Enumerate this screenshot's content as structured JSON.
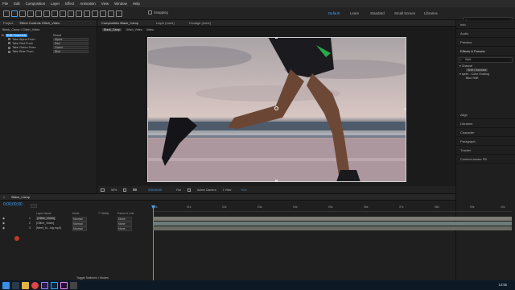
{
  "menu": [
    "File",
    "Edit",
    "Composition",
    "Layer",
    "Effect",
    "Animation",
    "View",
    "Window",
    "Help"
  ],
  "toolbar": {
    "snapping_label": "Snapping",
    "workspaces": [
      "Default",
      "Learn",
      "Standard",
      "Small Screen",
      "Libraries"
    ],
    "active_workspace": "Default",
    "search_placeholder": "Search Help"
  },
  "project_panel": {
    "tabs": [
      "Project",
      "Effect Controls Glitch_Video"
    ],
    "breadcrumb": "Black_Camp • Glitch_Video",
    "effect_name": "Shift Channels",
    "effect_reset": "Reset",
    "properties": [
      {
        "label": "Take Alpha From",
        "value": "Alpha"
      },
      {
        "label": "Take Red From",
        "value": "Red"
      },
      {
        "label": "Take Green From",
        "value": "Green"
      },
      {
        "label": "Take Blue From",
        "value": "Blue"
      }
    ]
  },
  "viewer": {
    "composition_tab": "Composition Black_Camp",
    "layer_tab": "Layer (none)",
    "footage_tab": "Footage (none)",
    "sub_tabs": [
      "Black_Camp",
      "Glitch_Video",
      "Video"
    ],
    "footer": {
      "zoom": "50%",
      "timecode": "0;00;00;00",
      "resolution": "Full",
      "camera": "Active Camera",
      "views": "1 View",
      "exposure": "+0.0"
    }
  },
  "right_panel": {
    "items": [
      "Info",
      "Audio",
      "Preview",
      "Effects & Presets",
      "Align",
      "Libraries",
      "Character",
      "Paragraph",
      "Tracker",
      "Content-Aware Fill"
    ],
    "effects_search": "Shift",
    "tree": {
      "channel_group": "Channel",
      "channel_effect": "Shift Channels",
      "synth_group": "synth - Color Grading",
      "synth_effect": "Blue Shift"
    }
  },
  "timeline": {
    "tab": "Black_Camp",
    "timecode": "0;00;00;00",
    "columns": [
      "Layer Name",
      "Mode",
      "T TrkMat",
      "Parent & Link"
    ],
    "ruler": [
      "00s",
      "01s",
      "02s",
      "03s",
      "04s",
      "05s",
      "06s",
      "07s",
      "08s",
      "09s",
      "10s"
    ],
    "layers": [
      {
        "num": "1",
        "name": "[Glitch_Video]",
        "mode": "Normal",
        "parent": "None"
      },
      {
        "num": "2",
        "name": "[Glitch_Video]",
        "mode": "Normal",
        "parent": "None"
      },
      {
        "num": "3",
        "name": "[Meet_to...ing.mp4]",
        "mode": "Normal",
        "parent": "None"
      }
    ],
    "footer": "Toggle Switches / Modes"
  },
  "taskbar": {
    "time": "14:55"
  },
  "colors": {
    "accent": "#3ea6ff",
    "selection": "#2d8ceb",
    "layer_bar": "#7d7d75"
  }
}
